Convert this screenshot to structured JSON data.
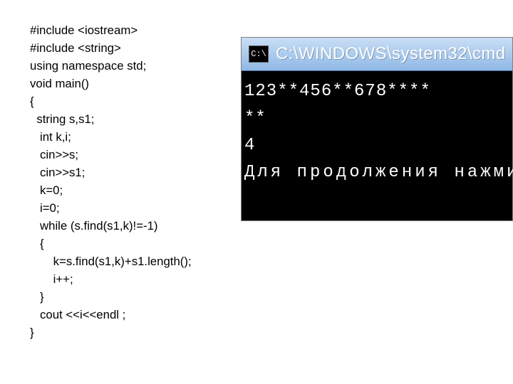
{
  "code": {
    "line1": "#include <iostream>",
    "line2": "#include <string>",
    "line3": "using namespace std;",
    "line4": "void main()",
    "line5": "{",
    "line6": "  string s,s1;",
    "line7": "   int k,i;",
    "line8": "   cin>>s;",
    "line9": "   cin>>s1;",
    "line10": "   k=0;",
    "line11": "   i=0;",
    "line12": "   while (s.find(s1,k)!=-1)",
    "line13": "   {",
    "line14": "       k=s.find(s1,k)+s1.length();",
    "line15": "       i++;",
    "line16": "   }",
    "line17": "   cout <<i<<endl ;",
    "line18": "}"
  },
  "console": {
    "icon_label": "C:\\",
    "title": "C:\\WINDOWS\\system32\\cmd",
    "line1": "123**456**678****",
    "line2": "**",
    "line3": "4",
    "line4": "Для продолжения нажмите"
  }
}
